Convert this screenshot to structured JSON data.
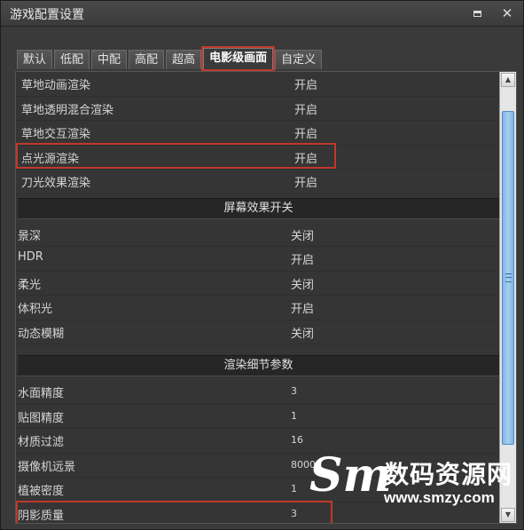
{
  "window": {
    "title": "游戏配置设置",
    "minimize_icon": "minimize-icon",
    "close_label": "✕"
  },
  "tabs": [
    {
      "label": "默认"
    },
    {
      "label": "低配"
    },
    {
      "label": "中配"
    },
    {
      "label": "高配"
    },
    {
      "label": "超高"
    },
    {
      "label": "电影级画面",
      "active": true
    },
    {
      "label": "自定义"
    }
  ],
  "settings": {
    "group1": [
      {
        "label": "草地动画渲染",
        "value": "开启"
      },
      {
        "label": "草地透明混合渲染",
        "value": "开启"
      },
      {
        "label": "草地交互渲染",
        "value": "开启"
      },
      {
        "label": "点光源渲染",
        "value": "开启",
        "highlighted": true
      },
      {
        "label": "刀光效果渲染",
        "value": "开启"
      }
    ],
    "section_screen": "屏幕效果开关",
    "group2": [
      {
        "label": "景深",
        "value": "关闭"
      },
      {
        "label": "HDR",
        "value": "开启"
      },
      {
        "label": "柔光",
        "value": "关闭"
      },
      {
        "label": "体积光",
        "value": "开启"
      },
      {
        "label": "动态模糊",
        "value": "关闭"
      }
    ],
    "section_render": "渲染细节参数",
    "group3": [
      {
        "label": "水面精度",
        "value": "3"
      },
      {
        "label": "贴图精度",
        "value": "1"
      },
      {
        "label": "材质过滤",
        "value": "16"
      },
      {
        "label": "摄像机远景",
        "value": "80000"
      },
      {
        "label": "植被密度",
        "value": "1"
      },
      {
        "label": "阴影质量",
        "value": "3",
        "highlighted": true
      }
    ]
  },
  "scrollbar": {
    "up_icon": "scroll-up-arrow-icon",
    "down_icon": "scroll-down-arrow-icon",
    "position_fraction": 0.05
  },
  "watermark": {
    "logo": "Sm",
    "name": "数码资源网",
    "url": "www.smzy.com"
  },
  "colors": {
    "highlight": "#c0392b",
    "thumb": "#7fb4e6"
  }
}
